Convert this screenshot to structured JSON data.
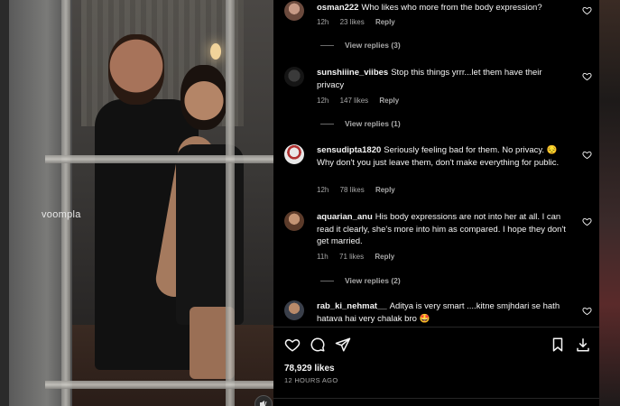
{
  "media": {
    "watermark": "voompla"
  },
  "comments": [
    {
      "username": "osman222",
      "text": "Who likes who more from the body expression?",
      "time": "12h",
      "likes": "23 likes",
      "reply": "Reply",
      "view_replies": "View replies (3)"
    },
    {
      "username": "sunshiiine_viibes",
      "text": "Stop this things yrrr...let them have their privacy",
      "time": "12h",
      "likes": "147 likes",
      "reply": "Reply",
      "view_replies": "View replies (1)"
    },
    {
      "username": "sensudipta1820",
      "text": "Seriously feeling bad for them. No privacy. 😔 Why don't you just leave them, don't make everything for public.",
      "time": "12h",
      "likes": "78 likes",
      "reply": "Reply",
      "view_replies": ""
    },
    {
      "username": "aquarian_anu",
      "text": "His body expressions are not into her at all. I can read it clearly, she's more into him as compared. I hope they don't get married.",
      "time": "11h",
      "likes": "71 likes",
      "reply": "Reply",
      "view_replies": "View replies (2)"
    },
    {
      "username": "rab_ki_nehmat__",
      "text": "Aditya is very smart ....kitne smjhdari se hath hatava hai very chalak bro 🤩",
      "time": "",
      "likes": "",
      "reply": "",
      "view_replies": ""
    }
  ],
  "post": {
    "likes": "78,929 likes",
    "time_ago": "12 HOURS AGO"
  },
  "icons": {
    "like": "heart-icon",
    "comment": "comment-icon",
    "share": "share-icon",
    "save": "bookmark-icon",
    "download": "download-icon",
    "audio": "audio-icon"
  },
  "colors": {
    "panel_bg": "#000000",
    "secondary_text": "#a8a8a8",
    "primary_text": "#f5f5f5"
  }
}
